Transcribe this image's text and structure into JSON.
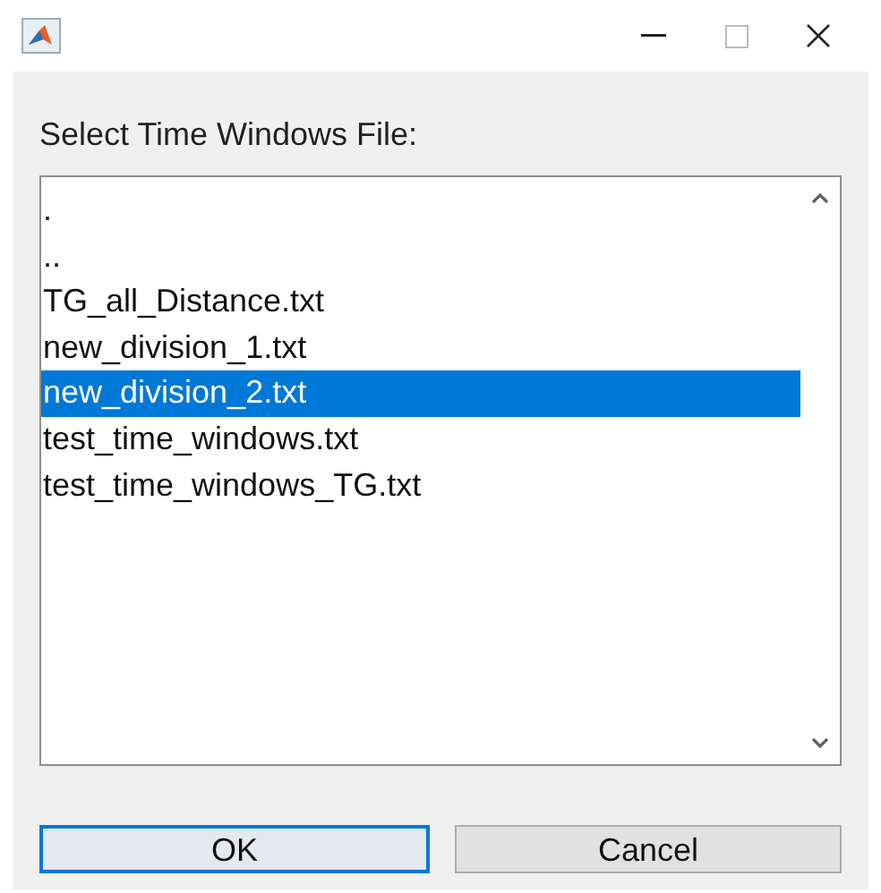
{
  "label": "Select Time Windows File:",
  "files": [
    {
      "name": ".",
      "selected": false
    },
    {
      "name": "..",
      "selected": false
    },
    {
      "name": "TG_all_Distance.txt",
      "selected": false
    },
    {
      "name": "new_division_1.txt",
      "selected": false
    },
    {
      "name": "new_division_2.txt",
      "selected": true
    },
    {
      "name": "test_time_windows.txt",
      "selected": false
    },
    {
      "name": "test_time_windows_TG.txt",
      "selected": false
    }
  ],
  "buttons": [
    {
      "label": "OK",
      "focused": true
    },
    {
      "label": "Cancel",
      "focused": false
    }
  ]
}
